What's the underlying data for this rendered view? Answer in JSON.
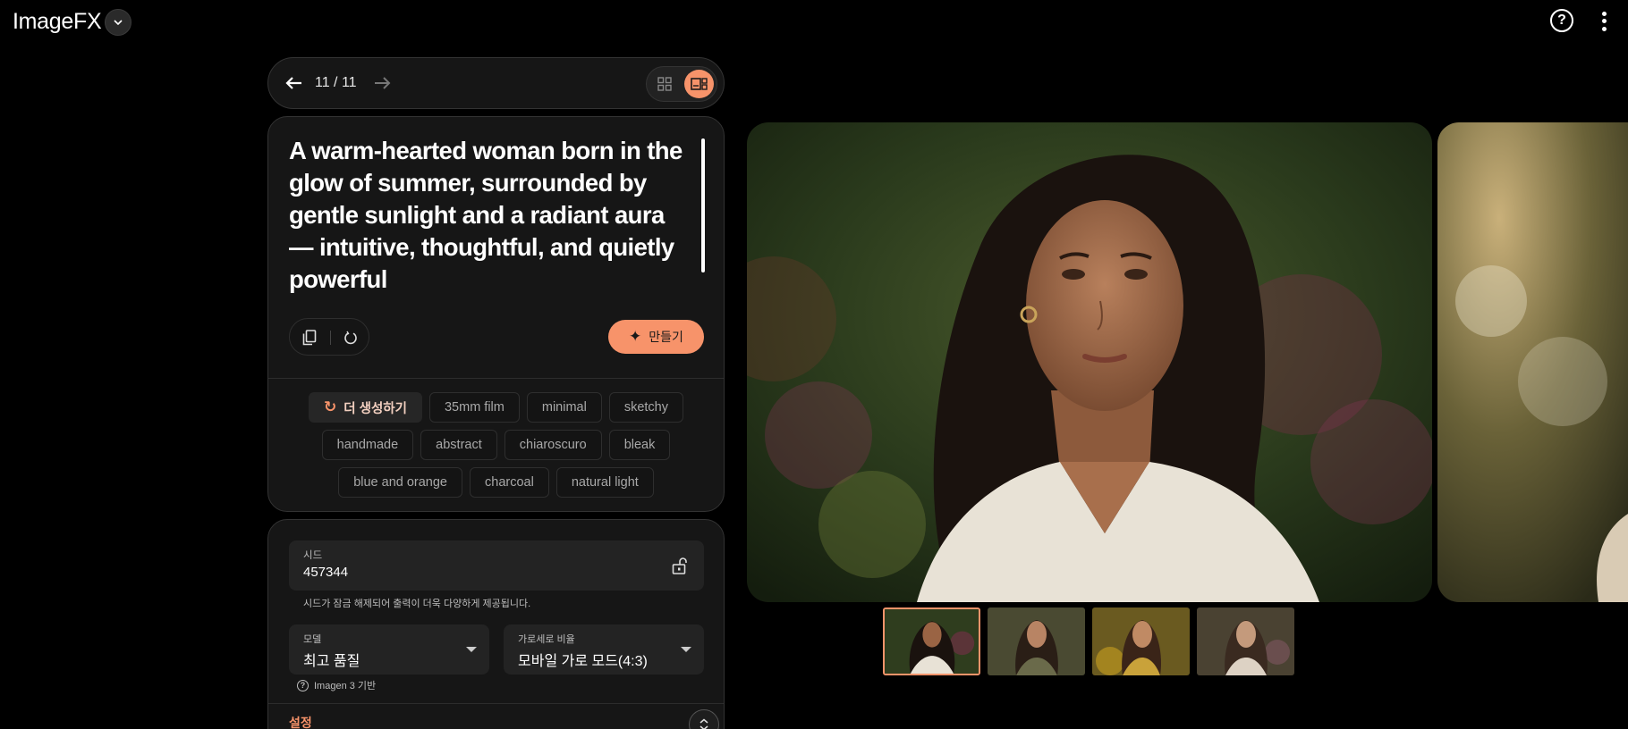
{
  "app": {
    "title": "ImageFX"
  },
  "nav": {
    "page_count": "11 / 11"
  },
  "prompt": {
    "text": "A warm-hearted woman born in the glow of summer, surrounded by gentle sunlight and a radiant aura — intuitive, thoughtful, and quietly powerful"
  },
  "actions": {
    "create_label": "만들기"
  },
  "chips": {
    "primary_label": "더 생성하기",
    "row1": [
      "35mm film",
      "minimal",
      "sketchy"
    ],
    "row2": [
      "handmade",
      "abstract",
      "chiaroscuro",
      "bleak"
    ],
    "row3": [
      "blue and orange",
      "charcoal",
      "natural light"
    ]
  },
  "settings": {
    "seed_label": "시드",
    "seed_value": "457344",
    "seed_help": "시드가 잠금 해제되어 출력이 더욱 다양하게 제공됩니다.",
    "model_label": "모델",
    "model_value": "최고 품질",
    "ratio_label": "가로세로 비율",
    "ratio_value": "모바일 가로 모드(4:3)",
    "model_note": "Imagen 3 기반",
    "heading": "설정"
  },
  "colors": {
    "accent": "#f7936a",
    "background": "#000000",
    "card": "#161616"
  },
  "icons": [
    "chevron-down-icon",
    "help-icon",
    "more-vert-icon",
    "arrow-back-icon",
    "arrow-forward-icon",
    "grid-icon",
    "detail-view-icon",
    "copy-icon",
    "reset-icon",
    "sparkle-icon",
    "refresh-icon",
    "lock-open-icon",
    "question-icon"
  ]
}
